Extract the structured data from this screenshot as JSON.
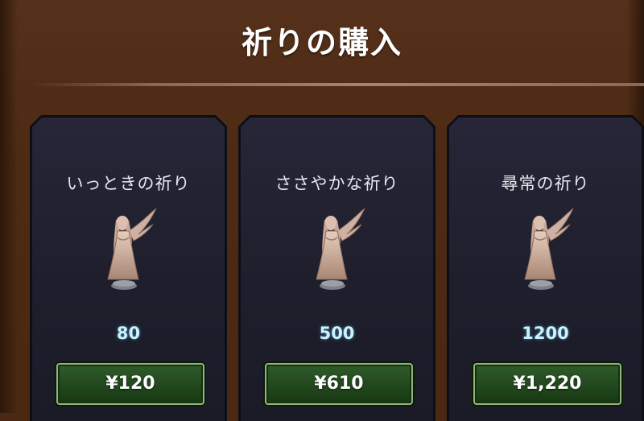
{
  "header": {
    "title": "祈りの購入"
  },
  "products": [
    {
      "name": "いっときの祈り",
      "amount": "80",
      "price": "¥120",
      "icon": "angel-statue-icon"
    },
    {
      "name": "ささやかな祈り",
      "amount": "500",
      "price": "¥610",
      "icon": "angel-statue-icon"
    },
    {
      "name": "尋常の祈り",
      "amount": "1200",
      "price": "¥1,220",
      "icon": "angel-statue-icon"
    }
  ],
  "colors": {
    "background": "#4a2812",
    "card": "#1e1e2c",
    "amount": "#c8f2ff",
    "button": "#234a1f",
    "button_border": "#8fb57c"
  }
}
